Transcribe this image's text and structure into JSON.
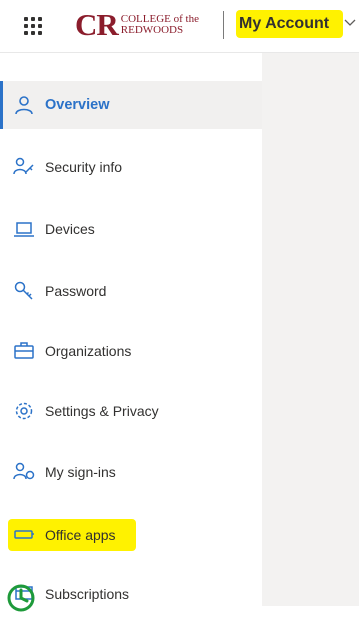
{
  "header": {
    "logo": {
      "mark": "CR",
      "line1": "COLLEGE of the",
      "line2": "REDWOODS"
    },
    "account_title": "My Account",
    "icons": {
      "waffle": "app-launcher-icon",
      "dropdown": "chevron-down-icon"
    }
  },
  "nav": {
    "items": [
      {
        "label": "Overview",
        "icon": "person-icon",
        "active": true
      },
      {
        "label": "Security info",
        "icon": "security-info-icon",
        "active": false
      },
      {
        "label": "Devices",
        "icon": "laptop-icon",
        "active": false
      },
      {
        "label": "Password",
        "icon": "key-icon",
        "active": false
      },
      {
        "label": "Organizations",
        "icon": "briefcase-icon",
        "active": false
      },
      {
        "label": "Settings & Privacy",
        "icon": "gear-icon",
        "active": false
      },
      {
        "label": "My sign-ins",
        "icon": "sign-ins-icon",
        "active": false
      },
      {
        "label": "Office apps",
        "icon": "office-apps-icon",
        "active": false,
        "highlighted": true
      },
      {
        "label": "Subscriptions",
        "icon": "subscriptions-icon",
        "active": false
      }
    ]
  },
  "colors": {
    "accent": "#2b72c8",
    "highlight": "#fff200",
    "brand": "#8b1d2c",
    "content_bg": "#f3f2f1",
    "active_bg": "#f1f0ef",
    "spinner": "#1e9a3a"
  }
}
